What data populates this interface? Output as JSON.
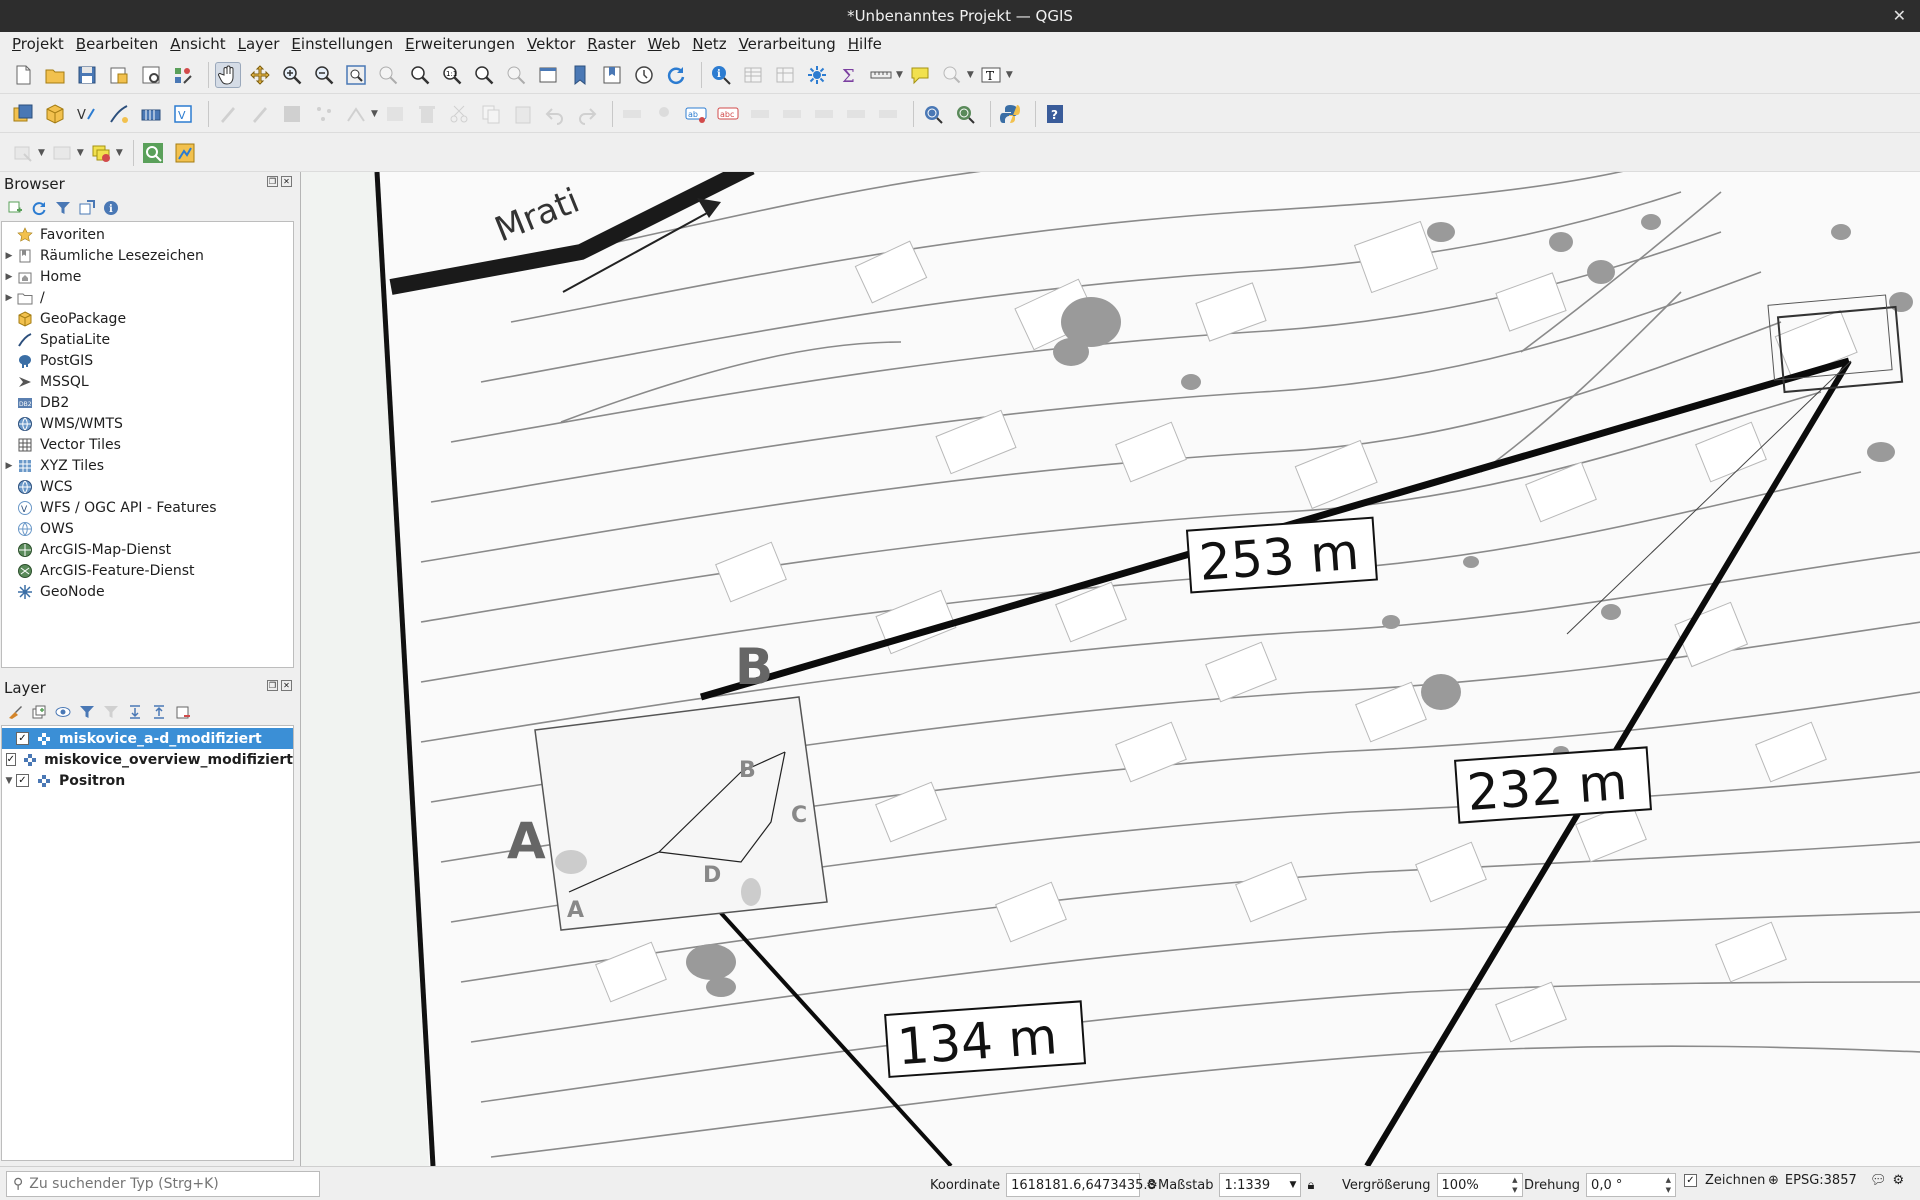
{
  "window": {
    "title": "*Unbenanntes Projekt — QGIS"
  },
  "menu": [
    {
      "u": "P",
      "rest": "rojekt"
    },
    {
      "u": "B",
      "rest": "earbeiten"
    },
    {
      "u": "A",
      "rest": "nsicht"
    },
    {
      "u": "L",
      "rest": "ayer"
    },
    {
      "u": "E",
      "rest": "instellungen"
    },
    {
      "u": "E",
      "rest": "rweiterungen"
    },
    {
      "u": "V",
      "rest": "ektor"
    },
    {
      "u": "R",
      "rest": "aster"
    },
    {
      "u": "W",
      "rest": "eb"
    },
    {
      "u": "N",
      "rest": "etz"
    },
    {
      "u": "V",
      "rest": "erarbeitung"
    },
    {
      "u": "H",
      "rest": "ilfe"
    }
  ],
  "browser": {
    "title": "Browser",
    "items": [
      {
        "label": "Favoriten",
        "icon": "star-icon",
        "expandable": false
      },
      {
        "label": "Räumliche Lesezeichen",
        "icon": "bookmark-icon",
        "expandable": true
      },
      {
        "label": "Home",
        "icon": "home-folder-icon",
        "expandable": true
      },
      {
        "label": "/",
        "icon": "folder-icon",
        "expandable": true
      },
      {
        "label": "GeoPackage",
        "icon": "geopackage-icon",
        "expandable": false
      },
      {
        "label": "SpatiaLite",
        "icon": "spatialite-icon",
        "expandable": false
      },
      {
        "label": "PostGIS",
        "icon": "postgis-icon",
        "expandable": false
      },
      {
        "label": "MSSQL",
        "icon": "mssql-icon",
        "expandable": false
      },
      {
        "label": "DB2",
        "icon": "db2-icon",
        "expandable": false
      },
      {
        "label": "WMS/WMTS",
        "icon": "wms-icon",
        "expandable": false
      },
      {
        "label": "Vector Tiles",
        "icon": "vector-tiles-icon",
        "expandable": false
      },
      {
        "label": "XYZ Tiles",
        "icon": "xyz-tiles-icon",
        "expandable": true
      },
      {
        "label": "WCS",
        "icon": "wcs-icon",
        "expandable": false
      },
      {
        "label": "WFS / OGC API - Features",
        "icon": "wfs-icon",
        "expandable": false
      },
      {
        "label": "OWS",
        "icon": "ows-icon",
        "expandable": false
      },
      {
        "label": "ArcGIS-Map-Dienst",
        "icon": "arcgis-map-icon",
        "expandable": false
      },
      {
        "label": "ArcGIS-Feature-Dienst",
        "icon": "arcgis-feature-icon",
        "expandable": false
      },
      {
        "label": "GeoNode",
        "icon": "geonode-icon",
        "expandable": false
      }
    ]
  },
  "layers": {
    "title": "Layer",
    "items": [
      {
        "label": "miskovice_a-d_modifiziert",
        "checked": true,
        "selected": true,
        "expandable": false
      },
      {
        "label": "miskovice_overview_modifiziert",
        "checked": true,
        "selected": false,
        "expandable": false
      },
      {
        "label": "Positron",
        "checked": true,
        "selected": false,
        "expandable": true
      }
    ]
  },
  "map": {
    "labels": {
      "street": "Mrati",
      "dist_253": "253 m",
      "dist_232": "232 m",
      "dist_134": "134 m",
      "point_a": "A",
      "point_b": "B",
      "inset_a": "A",
      "inset_b": "B",
      "inset_c": "C",
      "inset_d": "D"
    }
  },
  "status": {
    "search_placeholder": "Zu suchender Typ (Strg+K)",
    "coordinate_label": "Koordinate",
    "coordinate_value": "1618181.6,6473435.8",
    "scale_label": "Maßstab",
    "scale_value": "1:1339",
    "magnifier_label": "Vergrößerung",
    "magnifier_value": "100%",
    "rotation_label": "Drehung",
    "rotation_value": "0,0 °",
    "render_label": "Zeichnen",
    "render_checked": true,
    "crs": "EPSG:3857"
  }
}
